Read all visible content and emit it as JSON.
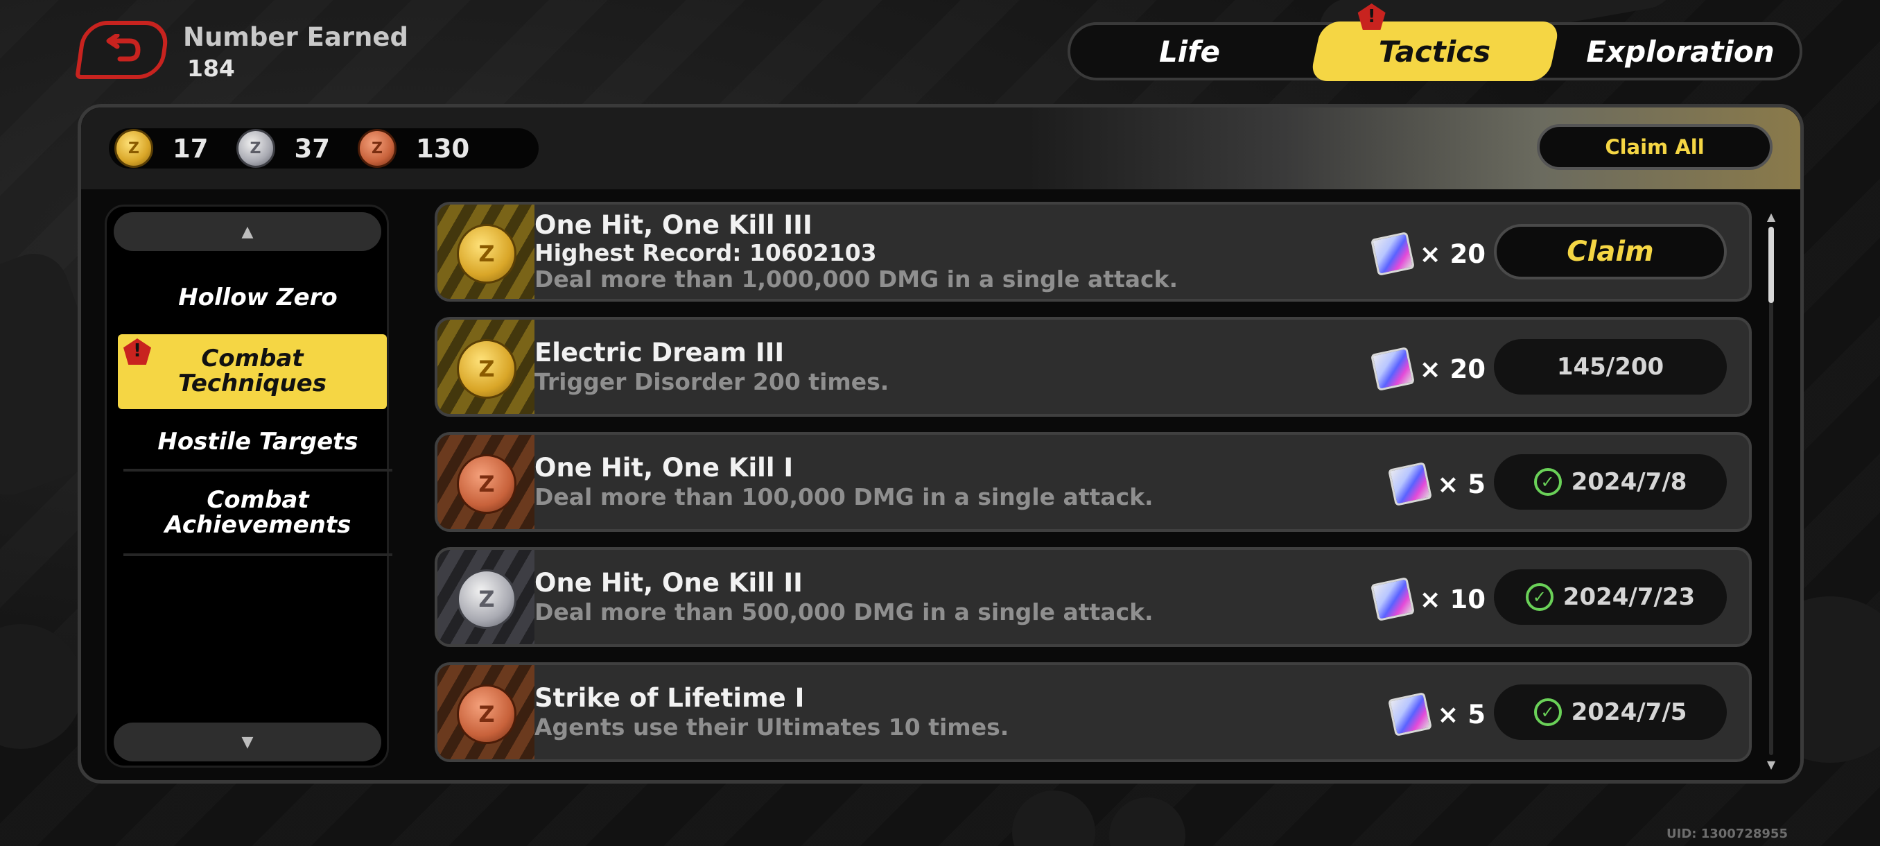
{
  "header": {
    "earned_label": "Number Earned",
    "earned_value": "184",
    "tabs": [
      {
        "label": "Life"
      },
      {
        "label": "Tactics",
        "active": true,
        "alert": "!"
      },
      {
        "label": "Exploration"
      }
    ]
  },
  "currency": {
    "gold": "17",
    "silver": "37",
    "bronze": "130",
    "coin_symbol": "Z"
  },
  "claim_all_label": "Claim All",
  "sidebar": {
    "items": [
      {
        "label": "Hollow Zero"
      },
      {
        "label": "Combat Techniques",
        "active": true,
        "alert": "!"
      },
      {
        "label": "Hostile Targets"
      },
      {
        "label": "Combat Achievements"
      }
    ],
    "up_arrow": "▲",
    "down_arrow": "▼"
  },
  "achievements": [
    {
      "tier": "gold",
      "title": "One Hit, One Kill III",
      "subtitle": "Highest Record: 10602103",
      "description": "Deal more than 1,000,000 DMG in a single attack.",
      "reward": "× 20",
      "status": "Claim"
    },
    {
      "tier": "gold",
      "title": "Electric Dream III",
      "description": "Trigger Disorder 200 times.",
      "reward": "× 20",
      "status": "145/200"
    },
    {
      "tier": "bronze",
      "title": "One Hit, One Kill I",
      "description": "Deal more than 100,000 DMG in a single attack.",
      "reward": "× 5",
      "status": "2024/7/8"
    },
    {
      "tier": "silver",
      "title": "One Hit, One Kill II",
      "description": "Deal more than 500,000 DMG in a single attack.",
      "reward": "× 10",
      "status": "2024/7/23"
    },
    {
      "tier": "bronze",
      "title": "Strike of Lifetime I",
      "description": "Agents use their Ultimates 10 times.",
      "reward": "× 5",
      "status": "2024/7/5"
    }
  ],
  "check_glyph": "✓",
  "uid": "UID: 1300728955",
  "colors": {
    "accent_yellow": "#f5d644",
    "back_red": "#c8231f",
    "check_green": "#6ad158"
  }
}
